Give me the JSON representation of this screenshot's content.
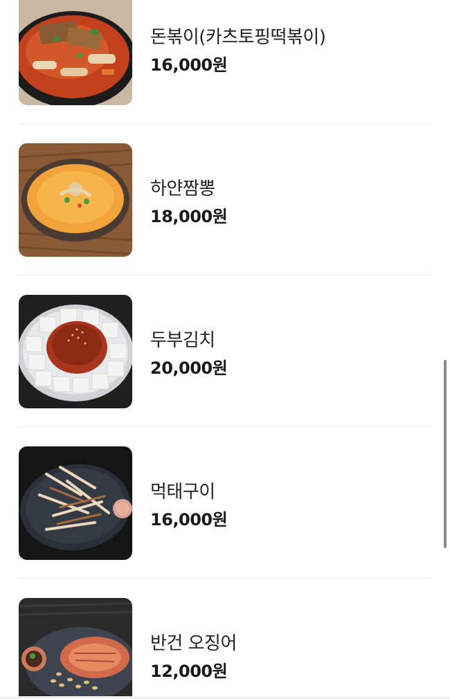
{
  "menu": {
    "items": [
      {
        "name": "돈볶이(카츠토핑떡볶이)",
        "price": "16,000원",
        "image": "tteokbokki-with-katsu-photo"
      },
      {
        "name": "하얀짬뽕",
        "price": "18,000원",
        "image": "white-jjamppong-photo"
      },
      {
        "name": "두부김치",
        "price": "20,000원",
        "image": "tofu-kimchi-photo"
      },
      {
        "name": "먹태구이",
        "price": "16,000원",
        "image": "grilled-pollock-photo"
      },
      {
        "name": "반건 오징어",
        "price": "12,000원",
        "image": "half-dried-squid-photo"
      }
    ]
  }
}
